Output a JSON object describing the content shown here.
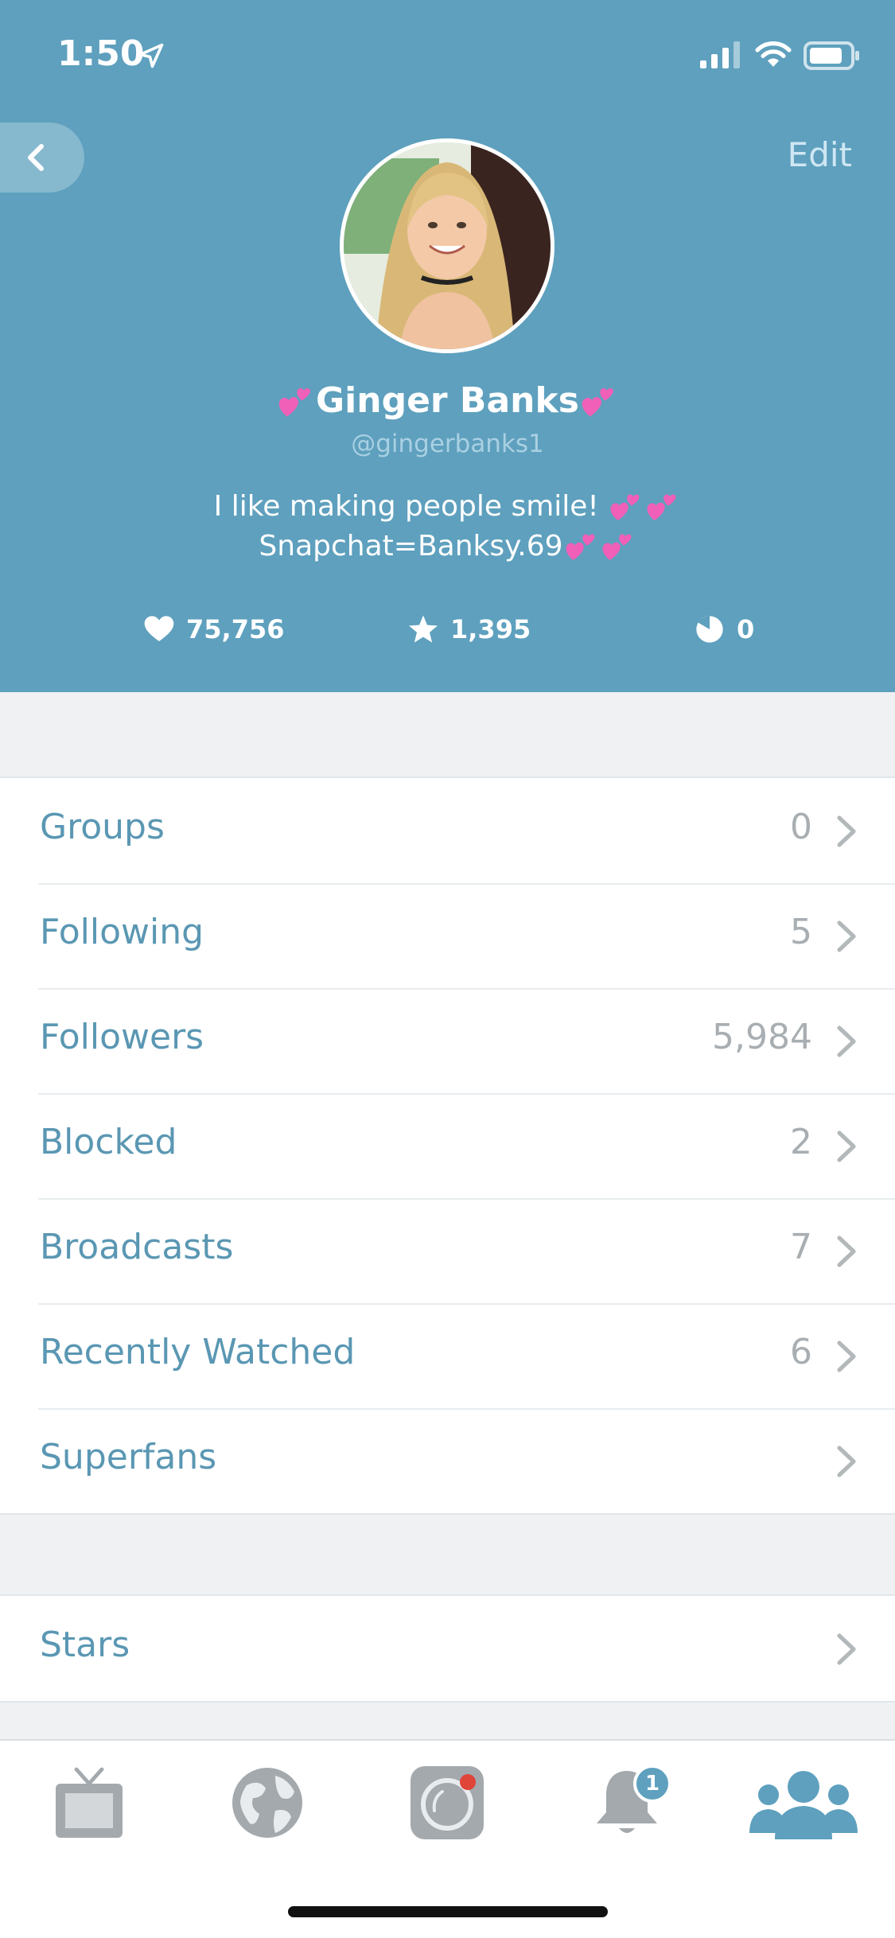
{
  "status_bar": {
    "time": "1:50"
  },
  "header": {
    "edit_label": "Edit",
    "display_name": "Ginger Banks",
    "username": "@gingerbanks1",
    "bio_line1": "I like making people smile!",
    "bio_line2": "Snapchat=Banksy.69",
    "stats": {
      "hearts": "75,756",
      "stars": "1,395",
      "pie": "0"
    }
  },
  "profile_list": [
    {
      "label": "Groups",
      "count": "0"
    },
    {
      "label": "Following",
      "count": "5"
    },
    {
      "label": "Followers",
      "count": "5,984"
    },
    {
      "label": "Blocked",
      "count": "2"
    },
    {
      "label": "Broadcasts",
      "count": "7"
    },
    {
      "label": "Recently Watched",
      "count": "6"
    },
    {
      "label": "Superfans",
      "count": ""
    }
  ],
  "secondary_list": [
    {
      "label": "Stars"
    }
  ],
  "tab_bar": {
    "notifications_badge": "1",
    "active_tab": "profile"
  },
  "colors": {
    "header_bg": "#5ea0be",
    "accent": "#5a97b3",
    "emoji_heart": "#f060b8"
  }
}
